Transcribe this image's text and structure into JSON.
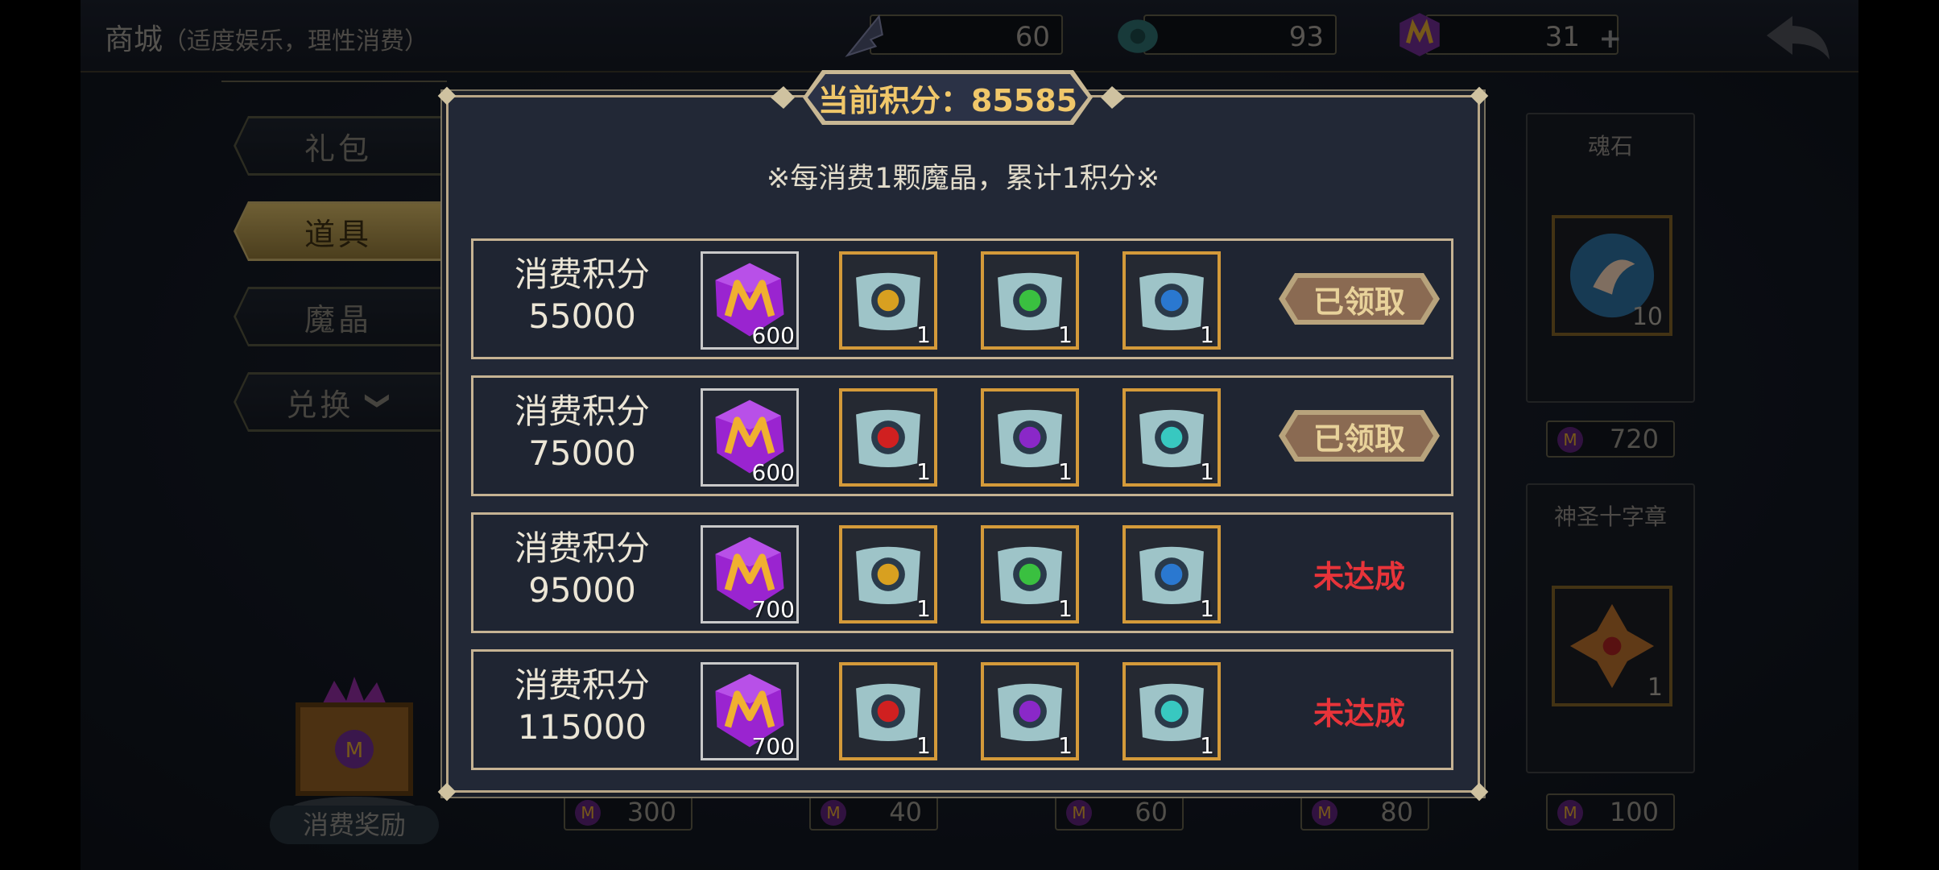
{
  "header": {
    "title": "商城",
    "subtitle": "（适度娱乐，理性消费）",
    "resources": [
      {
        "icon": "feather-icon",
        "value": "60"
      },
      {
        "icon": "jade-icon",
        "value": "93"
      },
      {
        "icon": "magic-crystal-icon",
        "value": "31",
        "plus": "+"
      }
    ]
  },
  "tabs": [
    {
      "label": "礼包",
      "active": false
    },
    {
      "label": "道具",
      "active": true
    },
    {
      "label": "魔晶",
      "active": false
    },
    {
      "label": "兑换",
      "active": false,
      "chevron": "❯"
    }
  ],
  "background": {
    "prices": [
      "300",
      "40",
      "60",
      "80",
      "100"
    ],
    "side_items": [
      {
        "name": "魂石",
        "qty": "10",
        "price": "720"
      },
      {
        "name": "神圣十字章",
        "qty": "1"
      }
    ],
    "rewards_label": "消费奖励"
  },
  "dialog": {
    "score": "当前积分：85585",
    "rule": "※每消费1颗魔晶，累计1积分※",
    "tiers": [
      {
        "label": "消费积分",
        "points": "55000",
        "crystal_qty": "600",
        "scrolls": [
          "sun",
          "leaf",
          "water"
        ],
        "scroll_qty": [
          "1",
          "1",
          "1"
        ],
        "status": "已领取",
        "claimed": true
      },
      {
        "label": "消费积分",
        "points": "75000",
        "crystal_qty": "600",
        "scrolls": [
          "fire",
          "shadow",
          "wind"
        ],
        "scroll_qty": [
          "1",
          "1",
          "1"
        ],
        "status": "已领取",
        "claimed": true
      },
      {
        "label": "消费积分",
        "points": "95000",
        "crystal_qty": "700",
        "scrolls": [
          "sun",
          "leaf",
          "water"
        ],
        "scroll_qty": [
          "1",
          "1",
          "1"
        ],
        "status": "未达成",
        "claimed": false
      },
      {
        "label": "消费积分",
        "points": "115000",
        "crystal_qty": "700",
        "scrolls": [
          "fire",
          "shadow",
          "wind"
        ],
        "scroll_qty": [
          "1",
          "1",
          "1"
        ],
        "status": "未达成",
        "claimed": false
      }
    ]
  },
  "colors": {
    "gold": "#f0c76a",
    "unmet_red": "#e8343a",
    "frame": "#c6b393"
  }
}
